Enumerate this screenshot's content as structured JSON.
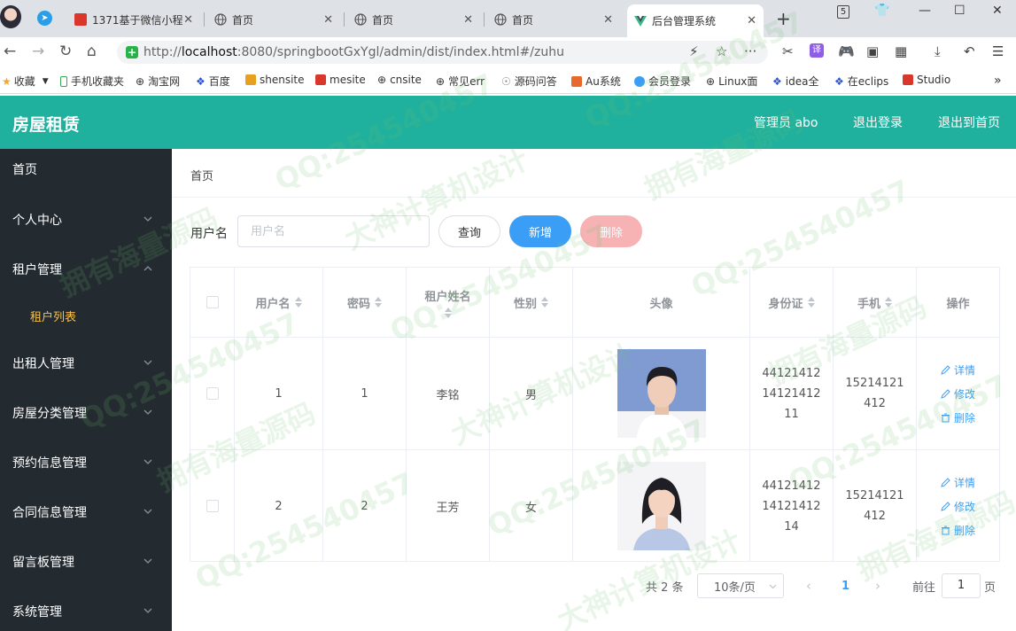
{
  "browser": {
    "tabs": [
      {
        "title": "1371基于微信小程"
      },
      {
        "title": "首页"
      },
      {
        "title": "首页"
      },
      {
        "title": "首页"
      },
      {
        "title": "后台管理系统"
      }
    ],
    "url_prefix": "http://",
    "url_host": "localhost",
    "url_rest": ":8080/springbootGxYgl/admin/dist/index.html#/zuhu",
    "bookmarks": [
      "收藏",
      "手机收藏夹",
      "淘宝网",
      "百度",
      "shensite",
      "mesite",
      "cnsite",
      "常见err",
      "源码问答",
      "Au系统",
      "会员登录",
      "Linux面",
      "idea全",
      "在eclips",
      "Studio"
    ],
    "win_badge": "5"
  },
  "header": {
    "title": "房屋租赁",
    "admin": "管理员 abo",
    "logout": "退出登录",
    "to_home": "退出到首页"
  },
  "sidebar": {
    "items": [
      {
        "label": "首页"
      },
      {
        "label": "个人中心"
      },
      {
        "label": "租户管理"
      },
      {
        "label": "出租人管理"
      },
      {
        "label": "房屋分类管理"
      },
      {
        "label": "预约信息管理"
      },
      {
        "label": "合同信息管理"
      },
      {
        "label": "留言板管理"
      },
      {
        "label": "系统管理"
      }
    ],
    "sub_item": "租户列表"
  },
  "breadcrumb": "首页",
  "search": {
    "label": "用户名",
    "placeholder": "用户名",
    "query": "查询",
    "add": "新增",
    "delete": "删除"
  },
  "table": {
    "headers": {
      "username": "用户名",
      "password": "密码",
      "name": "租户姓名",
      "gender": "性别",
      "avatar": "头像",
      "id_card": "身份证",
      "phone": "手机",
      "actions": "操作"
    },
    "rows": [
      {
        "username": "1",
        "password": "1",
        "name": "李铭",
        "gender": "男",
        "id_card": "441214121412141211",
        "phone": "15214121412"
      },
      {
        "username": "2",
        "password": "2",
        "name": "王芳",
        "gender": "女",
        "id_card": "441214121412141214",
        "phone": "15214121412"
      }
    ],
    "actions": {
      "detail": "详情",
      "edit": "修改",
      "delete": "删除"
    }
  },
  "pagination": {
    "total": "共 2 条",
    "page_size": "10条/页",
    "current": "1",
    "goto": "前往",
    "goto_value": "1",
    "page_suffix": "页"
  },
  "watermark": {
    "qq": "QQ:254540457",
    "t1": "大神计算机设计",
    "t2": "拥有海量源码"
  },
  "colors": {
    "header": "#1fb19e",
    "sidebar": "#232a30",
    "active_sub": "#f7c14a",
    "primary": "#3a9ef6",
    "danger_light": "#f7b2b4"
  }
}
